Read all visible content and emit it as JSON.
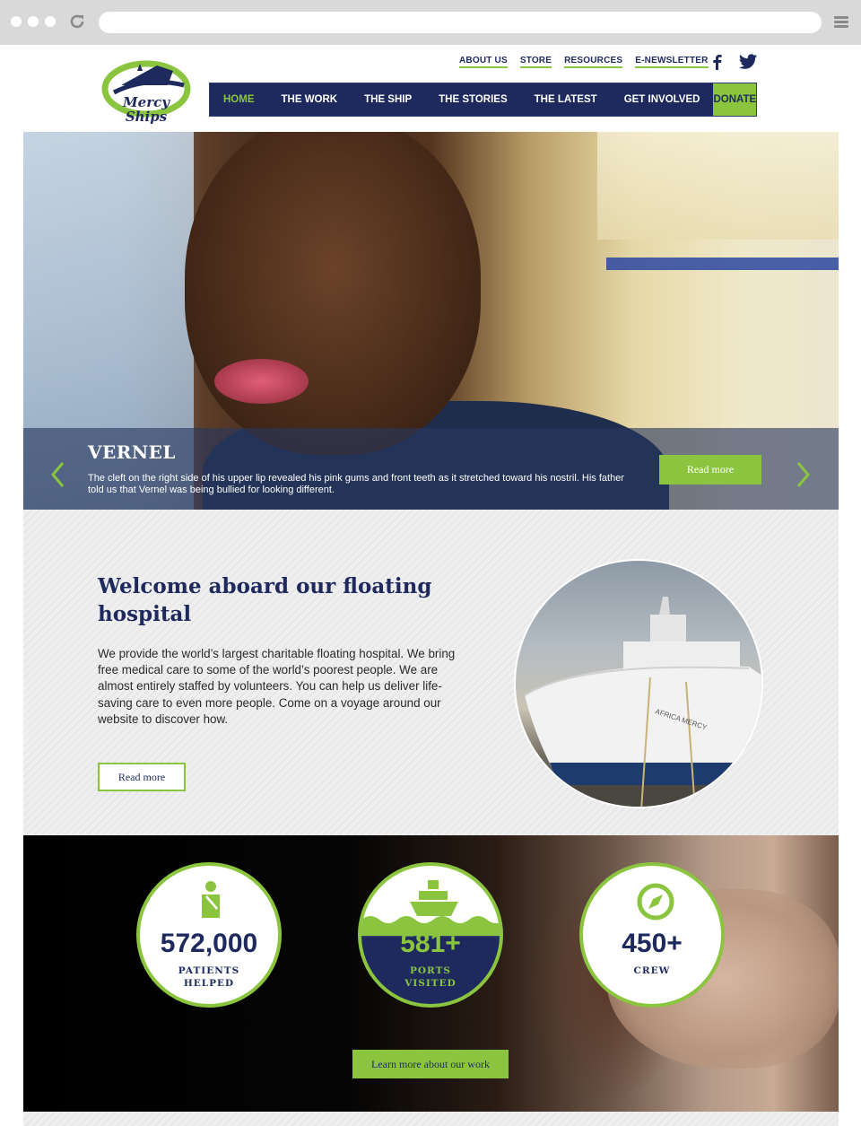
{
  "header": {
    "logo_text": "Mercy Ships",
    "top_links": [
      "ABOUT US",
      "STORE",
      "RESOURCES",
      "E-NEWSLETTER"
    ],
    "social": [
      "facebook-icon",
      "twitter-icon"
    ],
    "nav": [
      "HOME",
      "THE WORK",
      "THE SHIP",
      "THE STORIES",
      "THE LATEST",
      "GET INVOLVED"
    ],
    "donate_label": "DONATE"
  },
  "hero": {
    "name": "VERNEL",
    "text": "The cleft on the right side of his upper lip revealed his pink gums and front teeth as it stretched toward his nostril. His father told us that Vernel was being bullied for looking different.",
    "button": "Read more"
  },
  "welcome": {
    "title": "Welcome aboard our floating hospital",
    "body": "We provide the world’s largest charitable floating hospital. We bring free medical care to some of the world’s poorest people. We are almost entirely staffed by volunteers. You can help us deliver life-saving care to even more people. Come on a voyage around our website to discover how.",
    "button": "Read more",
    "ship_name": "AFRICA MERCY"
  },
  "stats": {
    "items": [
      {
        "value": "572,000",
        "label1": "PATIENTS",
        "label2": "HELPED",
        "icon": "patient-icon"
      },
      {
        "value": "581+",
        "label1": "PORTS",
        "label2": "VISITED",
        "icon": "ship-icon"
      },
      {
        "value": "450+",
        "label1": "CREW",
        "label2": "",
        "icon": "compass-icon"
      }
    ],
    "button": "Learn more about our work"
  },
  "colors": {
    "navy": "#1e2a5e",
    "green": "#8bc53f"
  }
}
